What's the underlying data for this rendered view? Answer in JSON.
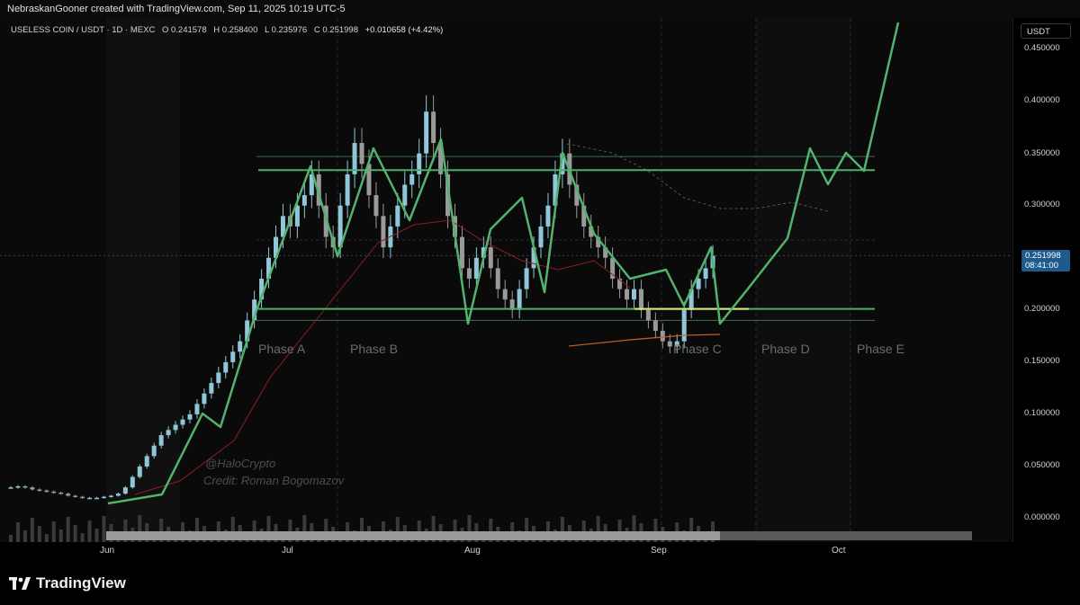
{
  "header": {
    "text": "NebraskanGooner created with TradingView.com, Sep 11, 2025 10:19 UTC-5"
  },
  "symbol_bar": {
    "symbol": "USELESS COIN / USDT · 1D · MEXC",
    "open": "O 0.241578",
    "high": "H 0.258400",
    "low": "L 0.235976",
    "close": "C 0.251998",
    "change": "+0.010658 (+4.42%)"
  },
  "price_scale": {
    "currency": "USDT",
    "labels": [
      "0.450000",
      "0.400000",
      "0.350000",
      "0.300000",
      "0.200000",
      "0.150000",
      "0.100000",
      "0.050000",
      "0.000000"
    ],
    "current_price": "0.251998",
    "countdown": "08:41:00"
  },
  "time_axis": {
    "labels": [
      "Jun",
      "Jul",
      "Aug",
      "Sep",
      "Oct"
    ]
  },
  "phases": [
    "Phase A",
    "Phase B",
    "Phase C",
    "Phase D",
    "Phase E"
  ],
  "watermark": {
    "handle": "@HaloCrypto",
    "credit": "Credit: Roman Bogomazov"
  },
  "footer": {
    "brand": "TradingView"
  },
  "colors": {
    "up_candle": "#8fc7d9",
    "down_candle": "#9a9a9a",
    "projection": "#52b36e",
    "range_line": "#4caf6a",
    "accent": "#1e5a8c"
  }
}
